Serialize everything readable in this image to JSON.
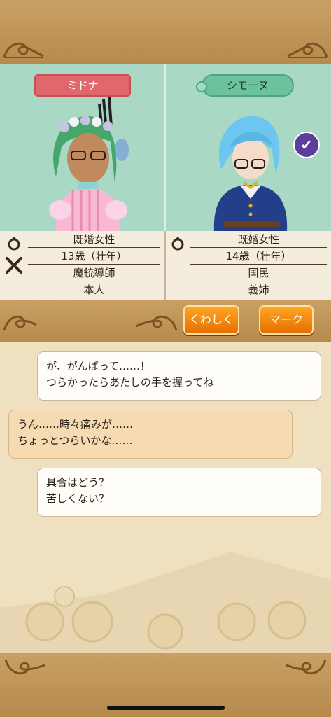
{
  "left_character": {
    "name": "ミドナ",
    "info": [
      "既婚女性",
      "13歳（壮年）",
      "魔銃導師",
      "本人"
    ]
  },
  "right_character": {
    "name": "シモーヌ",
    "info": [
      "既婚女性",
      "14歳（壮年）",
      "国民",
      "義姉"
    ]
  },
  "icons": {
    "left_ring": "ring-icon",
    "left_weapon": "crossed-swords-icon",
    "right_ring": "ring-icon",
    "badge": "checkmark-icon"
  },
  "buttons": {
    "details": "くわしく",
    "mark": "マーク"
  },
  "chat": [
    {
      "speaker": "right",
      "lines": [
        "が、がんばって……！",
        "つらかったらあたしの手を握ってね"
      ]
    },
    {
      "speaker": "left",
      "lines": [
        "うん……時々痛みが……",
        "ちょっとつらいかな……"
      ]
    },
    {
      "speaker": "right",
      "lines": [
        "具合はどう？",
        "苦しくない？"
      ]
    }
  ],
  "colors": {
    "frame": "#c9a064",
    "portrait_bg": "#a9d9c4",
    "left_name": "#e0676e",
    "right_name": "#6cc39b",
    "button": "#f58a0b"
  }
}
